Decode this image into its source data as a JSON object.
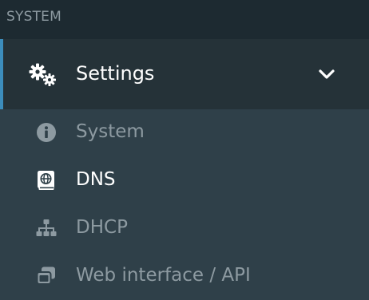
{
  "section": {
    "title": "SYSTEM"
  },
  "menu": {
    "parent": {
      "label": "Settings",
      "icon": "cogs-icon",
      "expanded": true
    },
    "items": [
      {
        "label": "System",
        "icon": "info-circle-icon",
        "active": false
      },
      {
        "label": "DNS",
        "icon": "address-book-globe-icon",
        "active": true
      },
      {
        "label": "DHCP",
        "icon": "sitemap-icon",
        "active": false
      },
      {
        "label": "Web interface / API",
        "icon": "window-restore-icon",
        "active": false
      }
    ]
  },
  "colors": {
    "accent": "#3c8dbc",
    "header_bg": "#1d2a31",
    "parent_bg": "#253238",
    "submenu_bg": "#2f4049",
    "muted_text": "#8d9aa1",
    "active_text": "#ffffff"
  }
}
